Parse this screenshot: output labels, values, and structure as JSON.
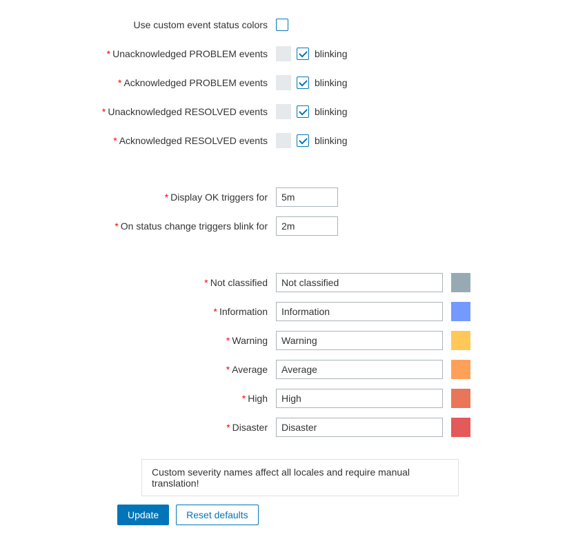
{
  "labels": {
    "use_custom_colors": "Use custom event status colors",
    "unack_problem": "Unacknowledged PROBLEM events",
    "ack_problem": "Acknowledged PROBLEM events",
    "unack_resolved": "Unacknowledged RESOLVED events",
    "ack_resolved": "Acknowledged RESOLVED events",
    "blinking": "blinking",
    "display_ok": "Display OK triggers for",
    "on_status_change": "On status change triggers blink for"
  },
  "values": {
    "display_ok": "5m",
    "on_status_change": "2m"
  },
  "event_rows": {
    "unack_problem": {
      "blinking_checked": true
    },
    "ack_problem": {
      "blinking_checked": true
    },
    "unack_resolved": {
      "blinking_checked": true
    },
    "ack_resolved": {
      "blinking_checked": true
    }
  },
  "custom_colors_checked": false,
  "severities": [
    {
      "label": "Not classified",
      "value": "Not classified",
      "color": "#97aab3"
    },
    {
      "label": "Information",
      "value": "Information",
      "color": "#7499ff"
    },
    {
      "label": "Warning",
      "value": "Warning",
      "color": "#ffc859"
    },
    {
      "label": "Average",
      "value": "Average",
      "color": "#ffa059"
    },
    {
      "label": "High",
      "value": "High",
      "color": "#e97659"
    },
    {
      "label": "Disaster",
      "value": "Disaster",
      "color": "#e45959"
    }
  ],
  "note": "Custom severity names affect all locales and require manual translation!",
  "buttons": {
    "update": "Update",
    "reset": "Reset defaults"
  },
  "colors": {
    "disabled_swatch": "#e6e9eb"
  }
}
